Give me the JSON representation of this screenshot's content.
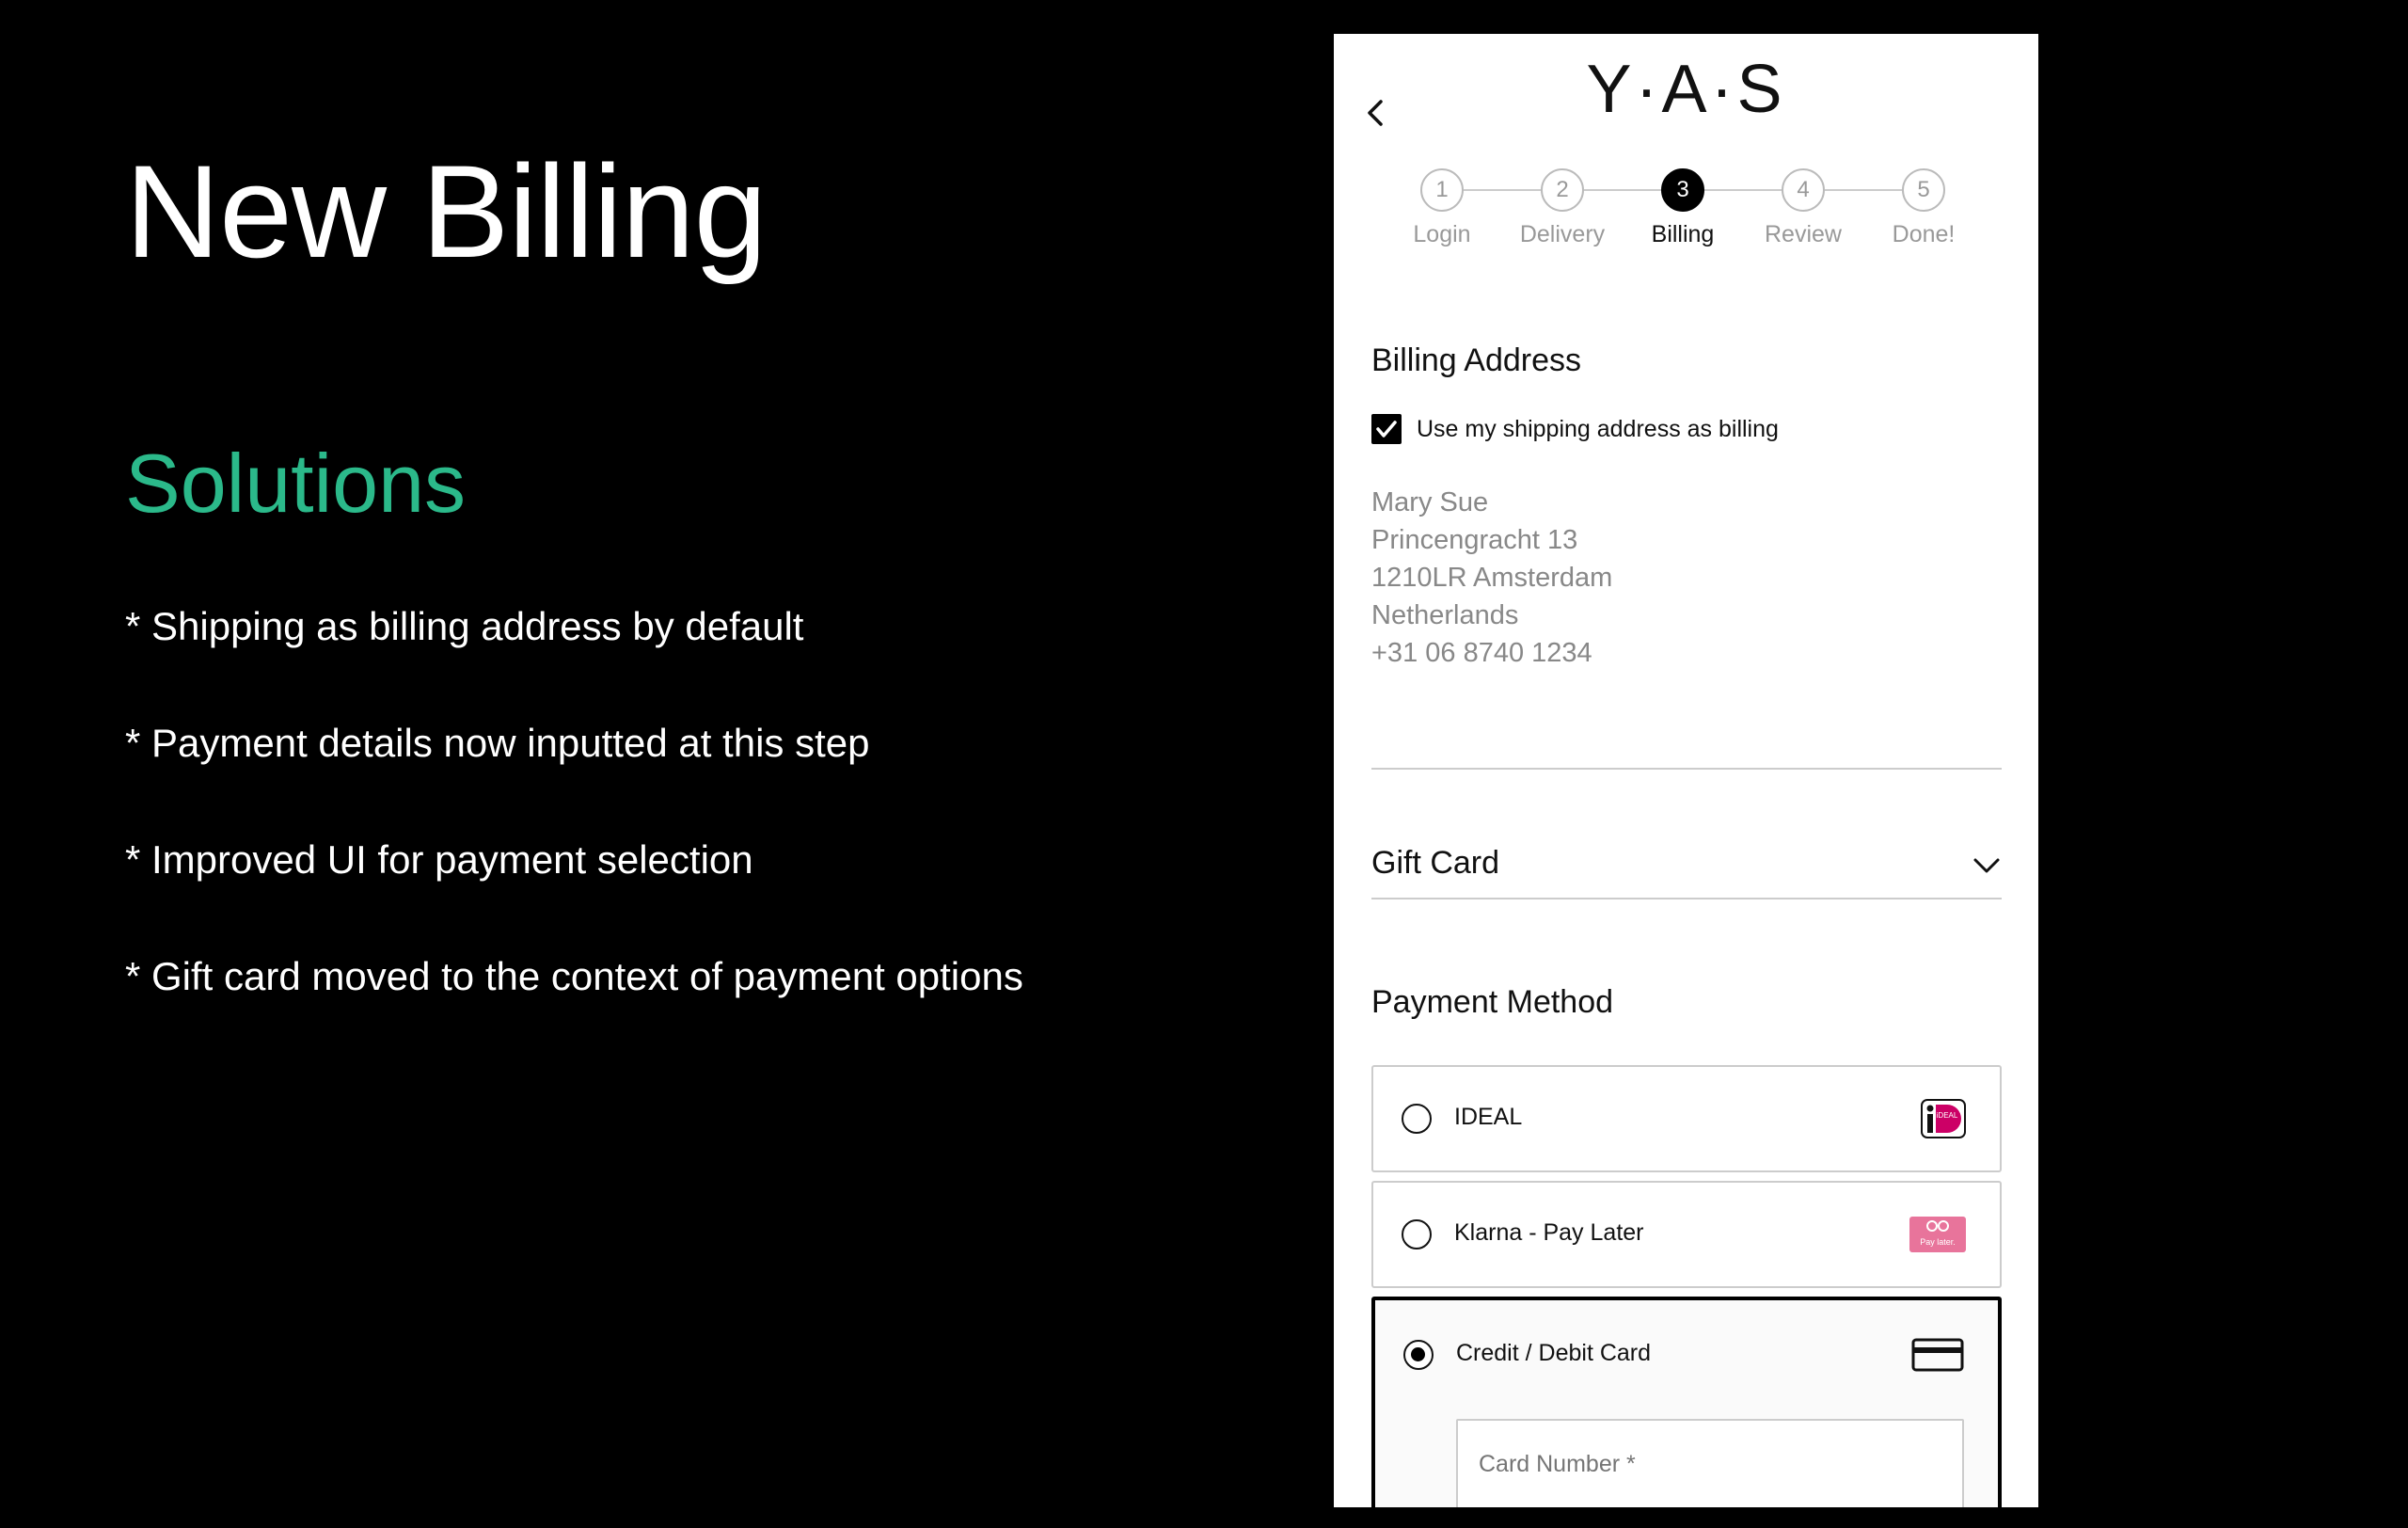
{
  "slide": {
    "title": "New Billing",
    "subtitle": "Solutions",
    "bullets": [
      "* Shipping as billing address by default",
      "* Payment details now inputted at this step",
      "* Improved UI for payment selection",
      "* Gift card moved to the context of payment options"
    ],
    "accent_color": "#2bb98a"
  },
  "app": {
    "logo": "Y·A·S",
    "back_icon": "chevron-left-icon",
    "steps": [
      {
        "number": "1",
        "label": "Login"
      },
      {
        "number": "2",
        "label": "Delivery"
      },
      {
        "number": "3",
        "label": "Billing",
        "active": true
      },
      {
        "number": "4",
        "label": "Review"
      },
      {
        "number": "5",
        "label": "Done!"
      }
    ],
    "billing_address": {
      "title": "Billing Address",
      "checkbox_label": "Use my shipping address as billing",
      "checked": true,
      "lines": [
        "Mary Sue",
        "Princengracht 13",
        "1210LR Amsterdam",
        "Netherlands",
        "+31 06 8740 1234"
      ]
    },
    "gift_card": {
      "title": "Gift Card",
      "icon": "chevron-down-icon"
    },
    "payment": {
      "title": "Payment Method",
      "options": [
        {
          "label": "IDEAL",
          "icon": "ideal-icon",
          "selected": false
        },
        {
          "label": "Klarna - Pay Later",
          "icon": "klarna-icon",
          "icon_text": "Pay later.",
          "selected": false
        },
        {
          "label": "Credit / Debit Card",
          "icon": "credit-card-icon",
          "selected": true
        }
      ],
      "card_number_placeholder": "Card Number *"
    }
  }
}
